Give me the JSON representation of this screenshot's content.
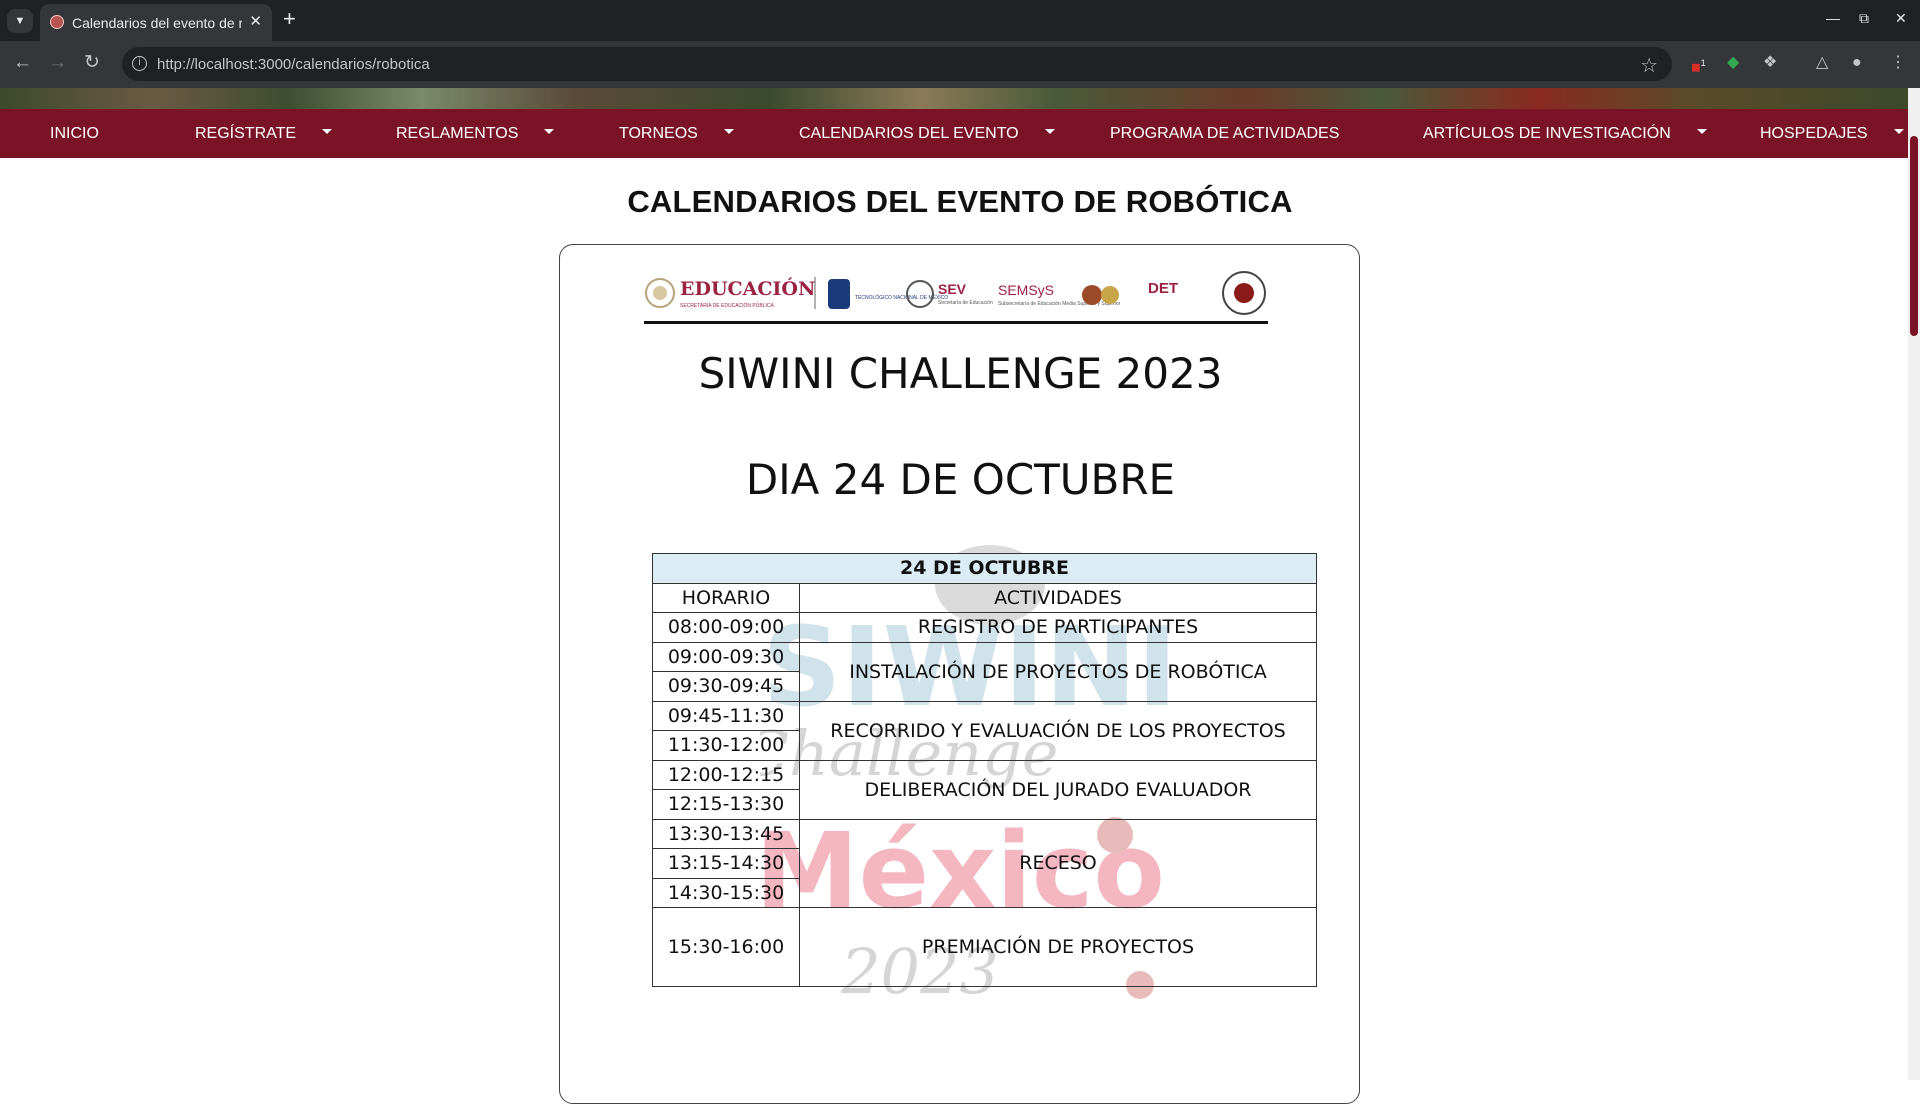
{
  "browser": {
    "tab_title": "Calendarios del evento de robótica",
    "new_tab": "+",
    "url": "http://localhost:3000/calendarios/robotica",
    "ext_badge": "1"
  },
  "nav": {
    "items": [
      {
        "label": "INICIO"
      },
      {
        "label": "REGÍSTRATE"
      },
      {
        "label": "REGLAMENTOS"
      },
      {
        "label": "TORNEOS"
      },
      {
        "label": "CALENDARIOS DEL EVENTO"
      },
      {
        "label": "PROGRAMA DE ACTIVIDADES"
      },
      {
        "label": "ARTÍCULOS DE INVESTIGACIÓN"
      },
      {
        "label": "HOSPEDAJES"
      }
    ]
  },
  "page": {
    "title": "CALENDARIOS DEL EVENTO DE ROBÓTICA"
  },
  "document": {
    "logos": {
      "educacion": "EDUCACIÓN",
      "educacion_sub": "SECRETARÍA DE EDUCACIÓN PÚBLICA",
      "tecnm": "TECNOLÓGICO NACIONAL DE MÉXICO",
      "sev": "SEV",
      "sev_sub": "Secretaría de Educación",
      "semsys": "SEMSyS",
      "semsys_sub": "Subsecretaría de Educación Media Superior y Superior",
      "det": "DET"
    },
    "challenge": "SIWINI CHALLENGE  2023",
    "day": "DIA 24 DE OCTUBRE",
    "watermark": {
      "word": "SIWINI",
      "script": "Challenge",
      "country": "México",
      "year": "2023"
    },
    "table": {
      "title": "24 DE OCTUBRE",
      "headers": {
        "time": "HORARIO",
        "activity": "ACTIVIDADES"
      },
      "times": [
        "08:00-09:00",
        "09:00-09:30",
        "09:30-09:45",
        "09:45-11:30",
        "11:30-12:00",
        "12:00-12:15",
        "12:15-13:30",
        "13:30-13:45",
        "13:15-14:30",
        "14:30-15:30",
        "15:30-16:00"
      ],
      "activities": [
        "REGISTRO DE PARTICIPANTES",
        "INSTALACIÓN DE PROYECTOS DE ROBÓTICA",
        "RECORRIDO Y EVALUACIÓN DE LOS PROYECTOS",
        "DELIBERACIÓN DEL JURADO EVALUADOR",
        "RECESO",
        "PREMIACIÓN DE PROYECTOS"
      ]
    }
  },
  "colors": {
    "navbar": "#7a1326",
    "table_header": "#dcecf5"
  }
}
